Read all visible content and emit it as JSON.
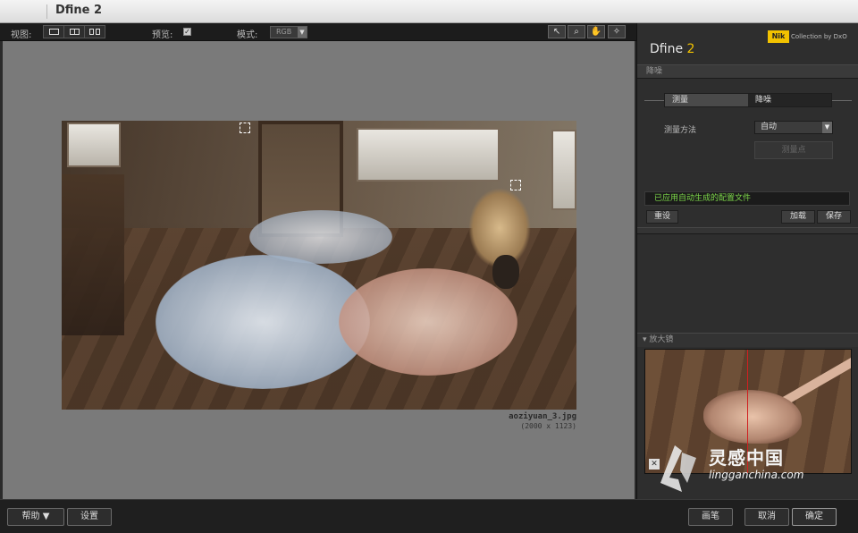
{
  "window": {
    "title": "Dfine 2"
  },
  "toolbar": {
    "view_label": "视图:",
    "preview_label": "预览:",
    "preview_checked": "✓",
    "mode_label": "模式:",
    "mode_value": "RGB",
    "tools": [
      "pointer-icon",
      "zoom-icon",
      "hand-icon",
      "loupe-icon"
    ]
  },
  "image": {
    "filename": "aoziyuan_3.jpg",
    "dimensions": "(2000 x 1123)"
  },
  "panel": {
    "brand_badge": "Nik",
    "brand_collection": "Collection by DxO",
    "product_name": "Dfine",
    "product_version": "2",
    "section_noise": "降噪",
    "tab_measure": "测量",
    "tab_reduce": "降噪",
    "measure_method_label": "测量方法",
    "measure_method_value": "自动",
    "measure_points_button": "测量点",
    "status_text": "已应用自动生成的配置文件",
    "reset_button": "重设",
    "load_button": "加载",
    "save_button": "保存",
    "loupe_label": "放大镜",
    "watermark_main": "灵感中国",
    "watermark_sub": "lingganchina.com"
  },
  "footer": {
    "help_button": "帮助",
    "settings_button": "设置",
    "brush_button": "画笔",
    "cancel_button": "取消",
    "ok_button": "确定"
  },
  "colors": {
    "accent": "#f2c200",
    "status_green": "#7dd84a",
    "loupe_line": "#d02020"
  }
}
